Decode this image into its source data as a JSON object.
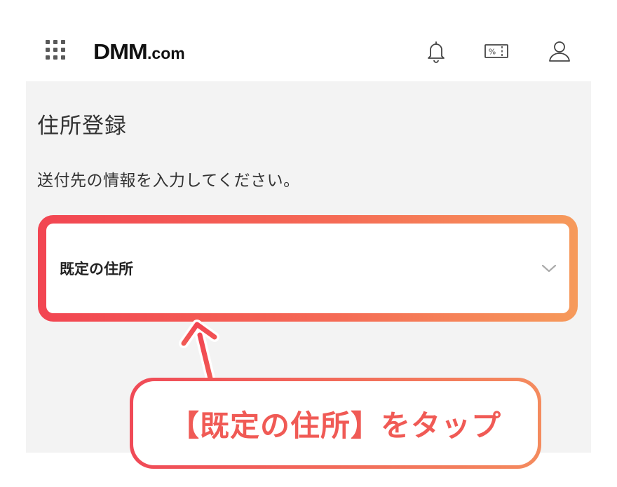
{
  "header": {
    "menu_icon": "grid-menu-icon",
    "logo_main": "DMM",
    "logo_suffix": ".com",
    "icons": [
      "bell-icon",
      "coupon-icon",
      "user-icon"
    ],
    "coupon_text": "%"
  },
  "page": {
    "title": "住所登録",
    "description": "送付先の情報を入力してください。"
  },
  "address_select": {
    "label": "既定の住所",
    "icon": "chevron-down-icon"
  },
  "callout": {
    "text": "【既定の住所】をタップ"
  },
  "colors": {
    "highlight_start": "#f24552",
    "highlight_end": "#f69a5b",
    "callout_text": "#f05a55",
    "background": "#f3f3f3"
  }
}
